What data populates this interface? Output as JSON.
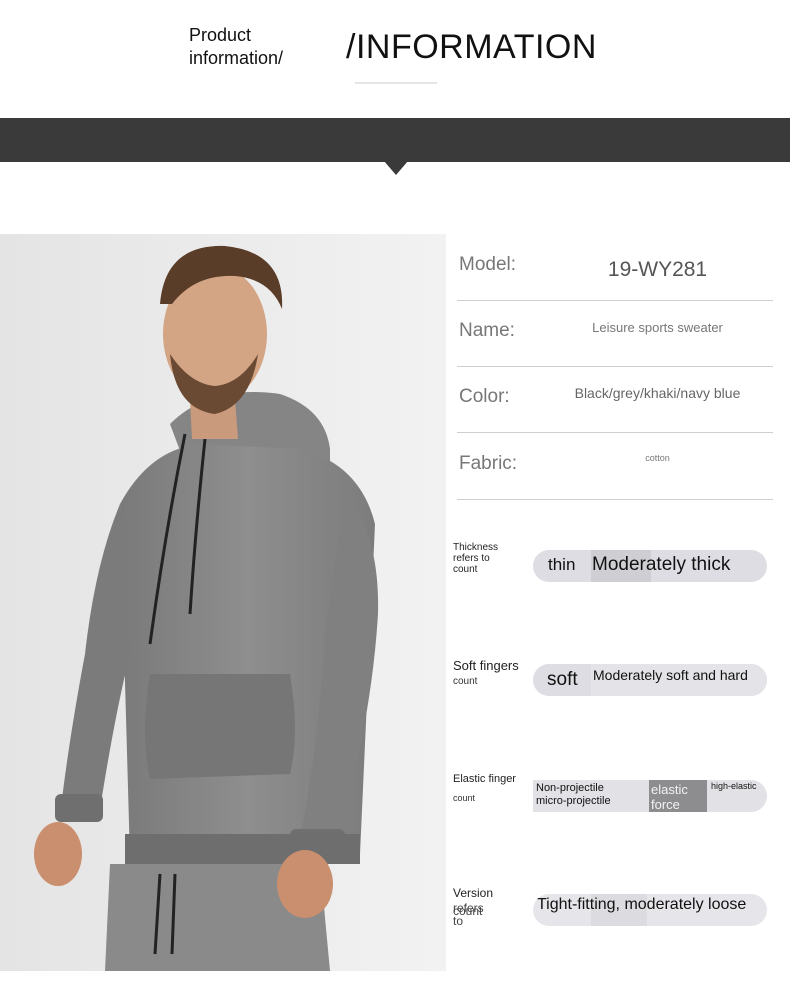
{
  "header": {
    "left_line1": "Product",
    "left_line2": "information/",
    "right": "/INFORMATION"
  },
  "specs": [
    {
      "key": "Model:",
      "value": "19-WY281"
    },
    {
      "key": "Name:",
      "value": "Leisure sports sweater"
    },
    {
      "key": "Color:",
      "value": "Black/grey/khaki/navy blue"
    },
    {
      "key": "Fabric:",
      "value": "cotton"
    }
  ],
  "attributes": {
    "thickness": {
      "label_line1": "Thickness",
      "label_line2": "refers to",
      "label_line3": "count",
      "opt_a": "thin",
      "opt_b": "Moderately thick"
    },
    "softness": {
      "label_line1": "Soft fingers",
      "label_line2": "count",
      "opt_a": "soft",
      "opt_b": "Moderately soft and hard"
    },
    "elastic": {
      "label_line1": "Elastic finger",
      "label_line2": "count",
      "opt_a_line1": "Non-projectile",
      "opt_a_line2": "micro-projectile",
      "opt_b_line1": "elastic",
      "opt_b_line2": "force",
      "opt_c": "high-elastic"
    },
    "version": {
      "label_line1": "Version",
      "label_line2": "refers to",
      "label_line3": "count",
      "opt_a": "Tight-fitting, moderately loose"
    }
  }
}
